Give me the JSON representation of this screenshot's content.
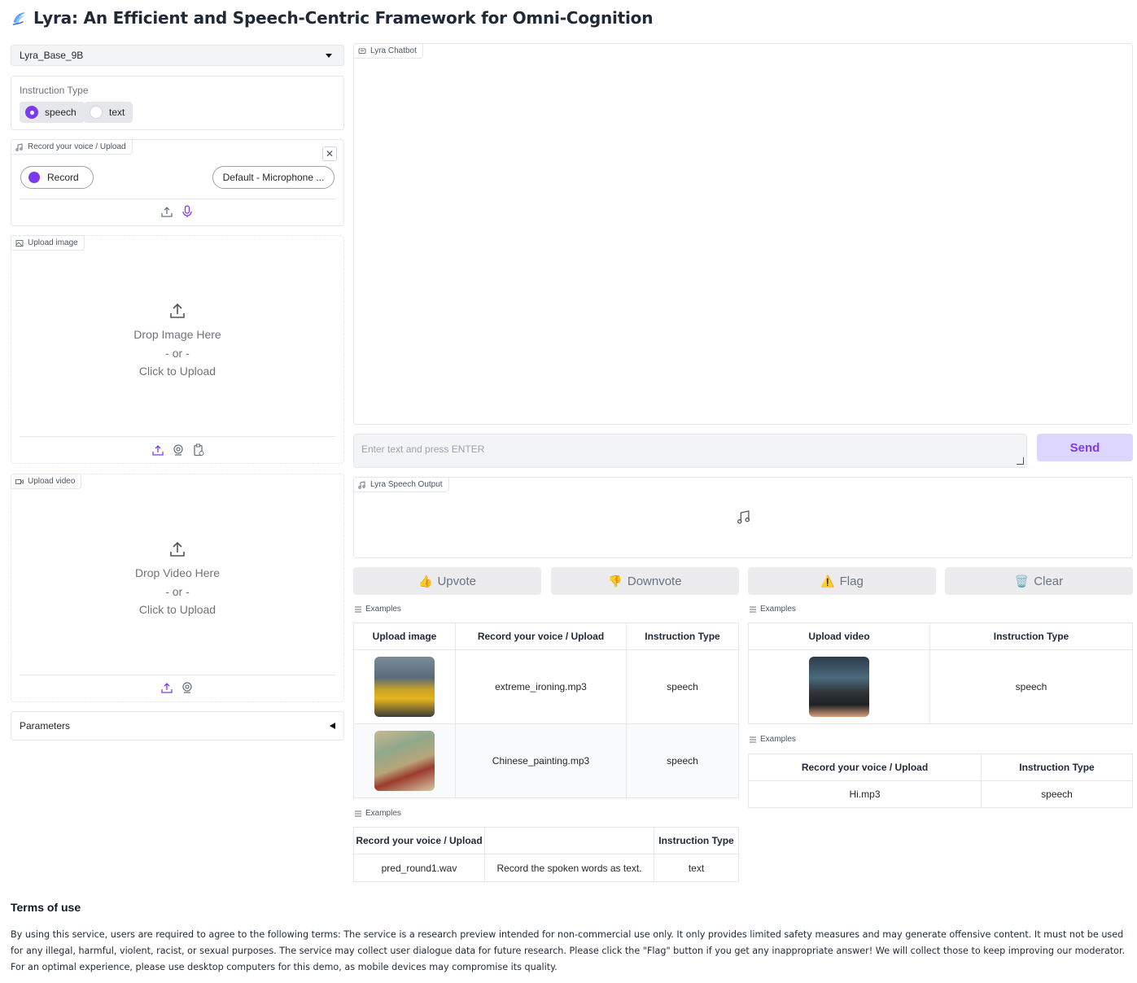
{
  "page": {
    "title": "Lyra: An Efficient and Speech-Centric Framework for Omni-Cognition"
  },
  "model_select": {
    "value": "Lyra_Base_9B"
  },
  "instruction_type": {
    "label": "Instruction Type",
    "options": [
      "speech",
      "text"
    ],
    "selected": "speech"
  },
  "voice_input": {
    "tag": "Record your voice / Upload",
    "record_label": "Record",
    "device_label": "Default - Microphone ..."
  },
  "image_input": {
    "tag": "Upload image",
    "drop": "Drop Image Here",
    "or": "- or -",
    "click": "Click to Upload"
  },
  "video_input": {
    "tag": "Upload video",
    "drop": "Drop Video Here",
    "or": "- or -",
    "click": "Click to Upload"
  },
  "parameters": {
    "label": "Parameters"
  },
  "chatbot": {
    "tag": "Lyra Chatbot"
  },
  "textbox": {
    "placeholder": "Enter text and press ENTER"
  },
  "send": {
    "label": "Send"
  },
  "speech_output": {
    "tag": "Lyra Speech Output"
  },
  "feedback": {
    "upvote": {
      "icon": "👍",
      "label": "Upvote"
    },
    "downvote": {
      "icon": "👎",
      "label": "Downvote"
    },
    "flag": {
      "icon": "⚠️",
      "label": "Flag"
    },
    "clear": {
      "icon": "🗑️",
      "label": "Clear"
    }
  },
  "examples_label": "Examples",
  "examples_image": {
    "headers": [
      "Upload image",
      "Record your voice / Upload",
      "Instruction Type"
    ],
    "rows": [
      {
        "audio": "extreme_ironing.mp3",
        "type": "speech"
      },
      {
        "audio": "Chinese_painting.mp3",
        "type": "speech"
      }
    ]
  },
  "examples_video": {
    "headers": [
      "Upload video",
      "Instruction Type"
    ],
    "rows": [
      {
        "type": "speech"
      }
    ]
  },
  "examples_voice": {
    "headers": [
      "Record your voice / Upload",
      "Instruction Type"
    ],
    "rows": [
      {
        "audio": "Hi.mp3",
        "type": "speech"
      }
    ]
  },
  "examples_text": {
    "headers": [
      "Record your voice / Upload",
      "",
      "Instruction Type"
    ],
    "rows": [
      {
        "audio": "pred_round1.wav",
        "text": "Record the spoken words as text.",
        "type": "text"
      }
    ]
  },
  "terms": {
    "heading": "Terms of use",
    "body": "By using this service, users are required to agree to the following terms: The service is a research preview intended for non-commercial use only. It only provides limited safety measures and may generate offensive content. It must not be used for any illegal, harmful, violent, racist, or sexual purposes. The service may collect user dialogue data for future research. Please click the \"Flag\" button if you get any inappropriate answer! We will collect those to keep improving our moderator. For an optimal experience, please use desktop computers for this demo, as mobile devices may compromise its quality."
  },
  "colors": {
    "accent": "#7c3aed",
    "accent_light": "#ddd6fe",
    "border": "#e5e7eb"
  }
}
